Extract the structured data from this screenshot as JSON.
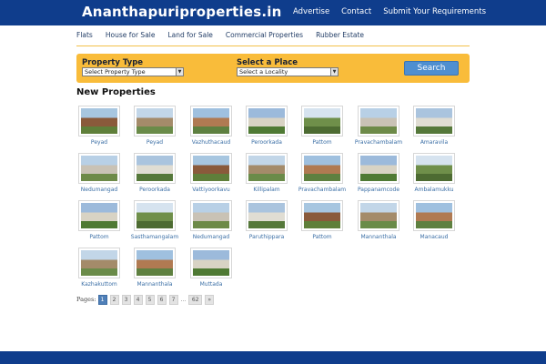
{
  "header": {
    "logo": "Ananthapuriproperties.in",
    "nav": [
      "Advertise",
      "Contact",
      "Submit Your Requirements"
    ]
  },
  "categories": [
    "Flats",
    "House for Sale",
    "Land for Sale",
    "Commercial Properties",
    "Rubber Estate"
  ],
  "search": {
    "type_label": "Property Type",
    "type_value": "Select Property Type",
    "place_label": "Select a Place",
    "place_value": "Select a Locality",
    "button": "Search"
  },
  "section_title": "New Properties",
  "properties": [
    "Peyad",
    "Peyad",
    "Vazhuthacaud",
    "Peroorkada",
    "Pattom",
    "Pravachambalam",
    "Amaravila",
    "Nedumangad",
    "Peroorkada",
    "Vattiyoorkavu",
    "Killipalam",
    "Pravachambalam",
    "Pappanamcode",
    "Ambalamukku",
    "Pattom",
    "Sasthamangalam",
    "Nedumangad",
    "Paruthippara",
    "Pattom",
    "Mannanthala",
    "Manacaud",
    "Kazhakuttom",
    "Mannanthala",
    "Muttada"
  ],
  "pagination": {
    "label": "Pages:",
    "pages": [
      "1",
      "2",
      "3",
      "4",
      "5",
      "6",
      "7"
    ],
    "dots": "...",
    "last": "62",
    "next": "»",
    "current": "1"
  },
  "colors": {
    "header_bg": "#0f3d8c",
    "search_bg": "#f9bc3a",
    "link": "#3a6ea5",
    "button": "#4f8fd0"
  }
}
